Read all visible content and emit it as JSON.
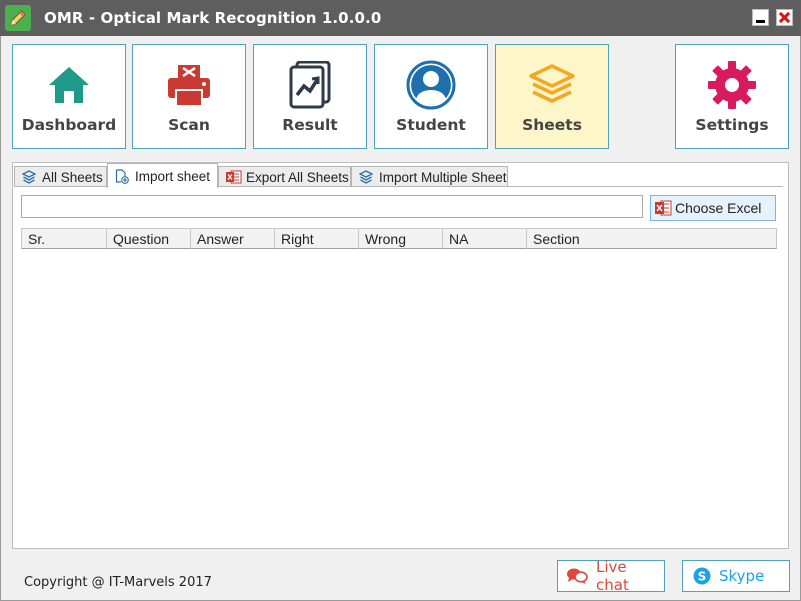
{
  "window": {
    "title": "OMR - Optical Mark Recognition 1.0.0.0"
  },
  "nav": {
    "dashboard": "Dashboard",
    "scan": "Scan",
    "result": "Result",
    "student": "Student",
    "sheets": "Sheets",
    "settings": "Settings",
    "active": "sheets"
  },
  "tabs": [
    {
      "label": "All Sheets",
      "icon": "layers-icon"
    },
    {
      "label": "Import sheet",
      "icon": "add-file-icon"
    },
    {
      "label": "Export All Sheets",
      "icon": "excel-icon"
    },
    {
      "label": "Import Multiple Sheet",
      "icon": "layers-icon"
    }
  ],
  "selected_tab": "Import sheet",
  "import": {
    "path_value": "",
    "choose_label": "Choose Excel"
  },
  "grid": {
    "columns": [
      "Sr.",
      "Question",
      "Answer",
      "Right",
      "Wrong",
      "NA",
      "Section"
    ],
    "rows": []
  },
  "footer": {
    "copyright": "Copyright @ IT-Marvels 2017",
    "livechat": "Live chat",
    "skype": "Skype"
  },
  "colors": {
    "tile_border": "#4fa3b5",
    "active_tile": "#fdf6c9",
    "dashboard": "#1f9a8a",
    "scan": "#c83a32",
    "result": "#2d3a4a",
    "student": "#1e6fae",
    "sheets": "#f5a623",
    "settings": "#d81b60",
    "livechat": "#e0463c",
    "skype": "#1aa3e8"
  }
}
